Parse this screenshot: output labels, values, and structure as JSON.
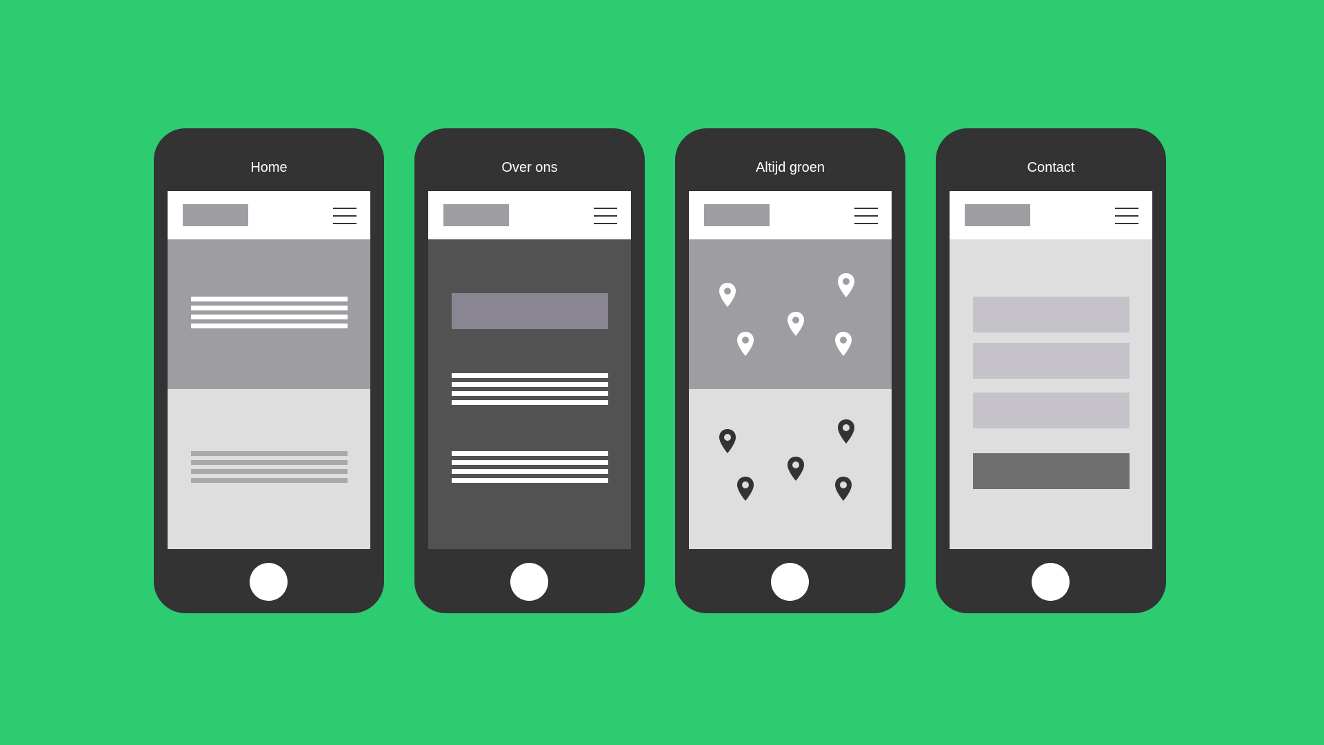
{
  "phones": [
    {
      "title": "Home"
    },
    {
      "title": "Over ons"
    },
    {
      "title": "Altijd groen"
    },
    {
      "title": "Contact"
    }
  ],
  "colors": {
    "background": "#2ecc71",
    "phone_body": "#333333",
    "placeholder_gray": "#9e9da2",
    "light_gray": "#dedede",
    "dark_gray": "#525252",
    "field_gray": "#c5c3c9",
    "button_gray": "#6f6f6f"
  }
}
